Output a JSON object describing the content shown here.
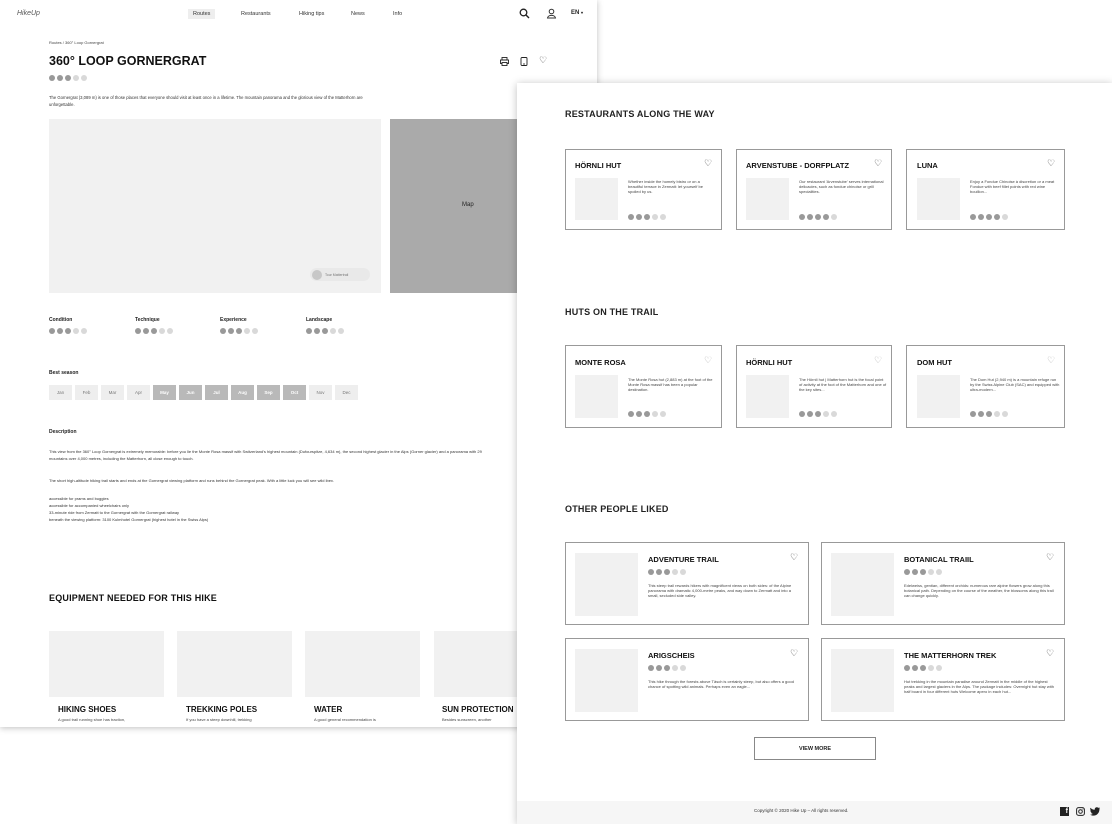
{
  "header": {
    "logo": "HikeUp",
    "nav": [
      "Routes",
      "Restaurants",
      "Hiking tips",
      "News",
      "Info"
    ],
    "lang": "EN"
  },
  "route": {
    "breadcrumb": "Routes / 360° Loop Gornergrat",
    "title": "360° LOOP GORNERGRAT",
    "difficulty": 3,
    "intro": "The Gornergrat (3,089 m) is one of those places that everyone should visit at least once in a lifetime. The mountain panorama and the glorious view of the Matterhorn are unforgettable.",
    "map_label": "Map",
    "map_pill": "Tour Mattertrail",
    "attributes": [
      {
        "label": "Condition",
        "value": 3
      },
      {
        "label": "Technique",
        "value": 3
      },
      {
        "label": "Experience",
        "value": 3
      },
      {
        "label": "Landscape",
        "value": 3
      }
    ],
    "best_season_title": "Best season",
    "months": [
      {
        "m": "Jan",
        "on": false
      },
      {
        "m": "Feb",
        "on": false
      },
      {
        "m": "Mar",
        "on": false
      },
      {
        "m": "Apr",
        "on": false
      },
      {
        "m": "May",
        "on": true
      },
      {
        "m": "Jun",
        "on": true
      },
      {
        "m": "Jul",
        "on": true
      },
      {
        "m": "Aug",
        "on": true
      },
      {
        "m": "Sep",
        "on": true
      },
      {
        "m": "Oct",
        "on": true
      },
      {
        "m": "Nov",
        "on": false
      },
      {
        "m": "Dec",
        "on": false
      }
    ],
    "description_title": "Description",
    "description_p1": "This view from the 360° Loop Gornergrat is extremely memorable: before you lie the Monte Rosa massif with Switzerland's highest mountain (Dufourspitze, 4,634 m), the second highest glacier in the Alps (Gorner glacier) and a panorama with 29 mountains over 4,000 metres, including the Matterhorn, all close enough to touch.",
    "description_p2": "The short high-altitude hiking trail starts and ends at the Gornergrat viewing platform and runs behind the Gornergrat peak. With a little luck you will see wild ibex.",
    "description_list": [
      "accessible for prams and buggies",
      "accessible for accompanied wheelchairs only",
      "33-minute ride from Zermatt to the Gornergrat with the Gornergrat railway",
      "beneath the viewing platform: 3100 Kulmhotel Gornergrat (highest hotel in the Swiss Alps)"
    ]
  },
  "equipment": {
    "title": "EQUIPMENT NEEDED FOR THIS HIKE",
    "items": [
      {
        "name": "HIKING SHOES",
        "desc": "A good trail running shoe has traction,"
      },
      {
        "name": "TREKKING POLES",
        "desc": "If you have a steep downhill, trekking"
      },
      {
        "name": "WATER",
        "desc": "A good general recommendation is"
      },
      {
        "name": "SUN PROTECTION",
        "desc": "Besides sunscreen, another"
      }
    ]
  },
  "restaurants": {
    "title": "RESTAURANTS ALONG THE WAY",
    "items": [
      {
        "name": "HÖRNLI HUT",
        "desc": "Whether inside the homely bistro or on a beautiful terrace in Zermatt: let yourself be spoiled by us.",
        "rating": 3
      },
      {
        "name": "ARVENSTUBE - DORFPLATZ",
        "desc": "Our restaurant 'Arvenstube' serves international delicacies, such as fondue chinoise or grill specialities.",
        "rating": 4
      },
      {
        "name": "LUNA",
        "desc": "Enjoy a Fondue Chinoise à discretion or a meat Fondue with beef fillet points with red wine bouillon...",
        "rating": 4
      }
    ]
  },
  "huts": {
    "title": "HUTS ON THE TRAIL",
    "items": [
      {
        "name": "MONTE ROSA",
        "desc": "The Monte Rosa hut (2,883 m) at the foot of the Monte Rosa massif has been a popular destination.",
        "rating": 3
      },
      {
        "name": "HÖRNLI HUT",
        "desc": "The Hörnli hut | Matterhorn hut is the focal point of activity at the foot of the Matterhorn and one of the key sites...",
        "rating": 3
      },
      {
        "name": "DOM HUT",
        "desc": "The Dom Hut (2,940 m) is a mountain refuge run by the Swiss Alpine Club (SAC) and equipped with ultra-modern...",
        "rating": 3
      }
    ]
  },
  "liked": {
    "title": "OTHER PEOPLE LIKED",
    "items": [
      {
        "name": "ADVENTURE TRAIL",
        "desc": "This steep trail rewards hikers with magnificent views on both sides: of the Alpine panorama with dramatic 4,000-metre peaks, and way down to Zermatt and into a small, secluded side valley.",
        "rating": 3
      },
      {
        "name": "BOTANICAL TRAIIL",
        "desc": "Edelweiss, gentian, different orchids: numerous rare alpine flowers grow along this botanical path. Depending on the course of the weather, the blossoms along this trail can change quickly.",
        "rating": 3
      },
      {
        "name": "ARIGSCHEIS",
        "desc": "This hike through the forests above Täsch is certainly steep, but also offers a good chance of spotting wild animals. Perhaps even an eagle...",
        "rating": 3
      },
      {
        "name": "THE MATTERHORN TREK",
        "desc": "Hut trekking in the mountain paradise around Zermatt in the middle of the highest peaks and largest glaciers in the Alps. The package includes: Overnight hut stay with half board in four different huts Welcome apero in each hut...",
        "rating": 3
      }
    ],
    "view_more": "VIEW MORE"
  },
  "footer": {
    "copyright": "Copyright © 2020 Hike Up – All rights reserved."
  }
}
